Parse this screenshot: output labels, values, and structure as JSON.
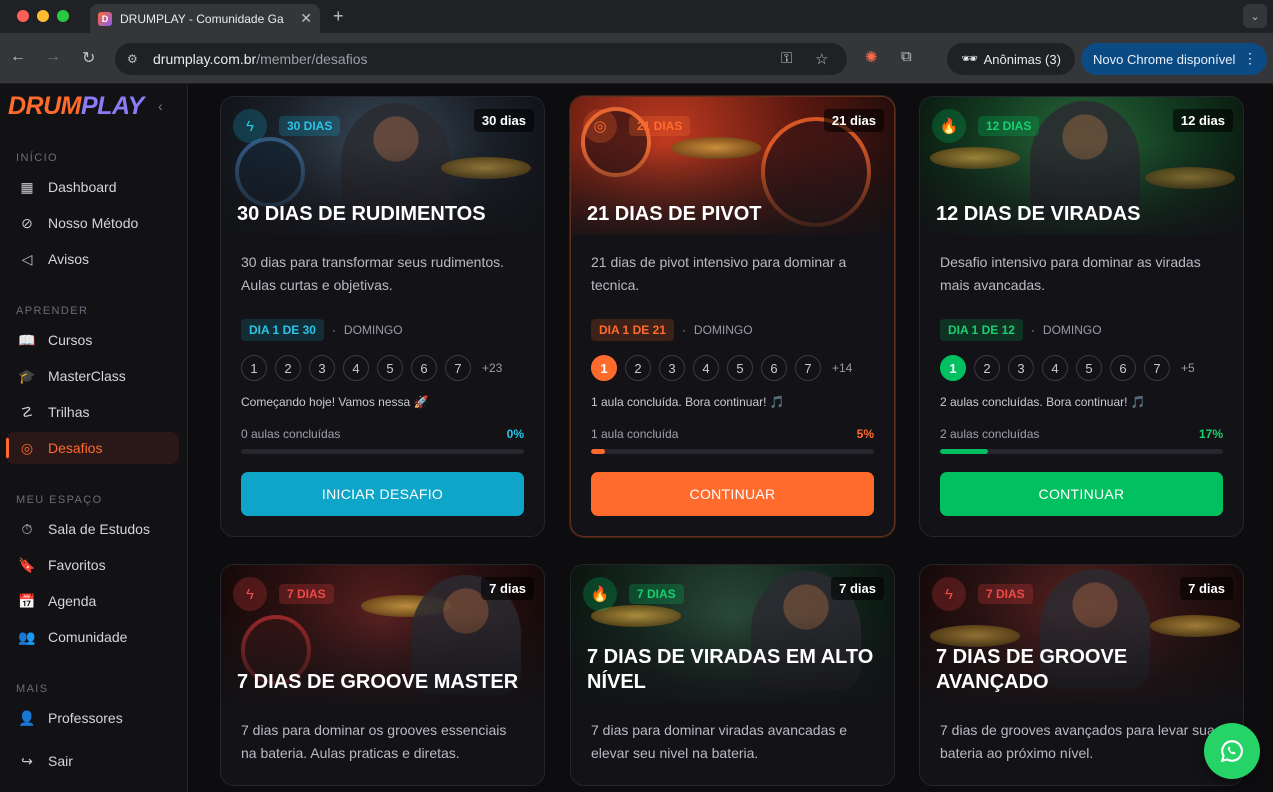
{
  "browser": {
    "tab_title": "DRUMPLAY - Comunidade Ga",
    "tab_favicon": "D",
    "url_host": "drumplay.com.br",
    "url_path": "/member/desafios",
    "incognito_label": "Anônimas (3)",
    "update_label": "Novo Chrome disponível"
  },
  "brand": {
    "part1": "DRUM",
    "part2": "PLAY"
  },
  "sidebar": {
    "sections": [
      {
        "title": "INÍCIO"
      },
      {
        "title": "APRENDER"
      },
      {
        "title": "MEU ESPAÇO"
      },
      {
        "title": "MAIS"
      }
    ],
    "items": [
      {
        "label": "Dashboard",
        "icon": "grid-icon"
      },
      {
        "label": "Nosso Método",
        "icon": "compass-icon"
      },
      {
        "label": "Avisos",
        "icon": "megaphone-icon"
      },
      {
        "label": "Cursos",
        "icon": "book-icon"
      },
      {
        "label": "MasterClass",
        "icon": "graduation-cap-icon"
      },
      {
        "label": "Trilhas",
        "icon": "route-icon"
      },
      {
        "label": "Desafios",
        "icon": "target-icon",
        "active": true
      },
      {
        "label": "Sala de Estudos",
        "icon": "timer-icon"
      },
      {
        "label": "Favoritos",
        "icon": "bookmark-icon"
      },
      {
        "label": "Agenda",
        "icon": "calendar-icon"
      },
      {
        "label": "Comunidade",
        "icon": "users-icon"
      },
      {
        "label": "Professores",
        "icon": "user-icon"
      },
      {
        "label": "Sair",
        "icon": "logout-icon"
      }
    ]
  },
  "cards": [
    {
      "title": "30 DIAS DE RUDIMENTOS",
      "pill": "30 DIAS",
      "duration": "30 dias",
      "description": "30 dias para transformar seus rudimentos. Aulas curtas e objetivas.",
      "day_label": "DIA 1 DE 30",
      "weekday": "DOMINGO",
      "days": [
        "1",
        "2",
        "3",
        "4",
        "5",
        "6",
        "7"
      ],
      "more": "+23",
      "status": "Começando hoje! Vamos nessa 🚀",
      "progress_label": "0 aulas concluídas",
      "progress_pct": "0%",
      "progress": 0,
      "button": "INICIAR DESAFIO",
      "accent": "#0ea5c9",
      "icon": "bolt-icon"
    },
    {
      "title": "21 DIAS DE PIVOT",
      "pill": "21 DIAS",
      "duration": "21 dias",
      "description": "21 dias de pivot intensivo para dominar a tecnica.",
      "day_label": "DIA 1 DE 21",
      "weekday": "DOMINGO",
      "days": [
        "1",
        "2",
        "3",
        "4",
        "5",
        "6",
        "7"
      ],
      "more": "+14",
      "status": "1 aula concluída. Bora continuar! 🎵",
      "progress_label": "1 aula concluída",
      "progress_pct": "5%",
      "progress": 0.05,
      "button": "CONTINUAR",
      "accent": "#ff6b2c",
      "icon": "target-icon"
    },
    {
      "title": "12 DIAS DE VIRADAS",
      "pill": "12 DIAS",
      "duration": "12 dias",
      "description": "Desafio intensivo para dominar as viradas mais avancadas.",
      "day_label": "DIA 1 DE 12",
      "weekday": "DOMINGO",
      "days": [
        "1",
        "2",
        "3",
        "4",
        "5",
        "6",
        "7"
      ],
      "more": "+5",
      "status": "2 aulas concluídas. Bora continuar! 🎵",
      "progress_label": "2 aulas concluídas",
      "progress_pct": "17%",
      "progress": 0.17,
      "button": "CONTINUAR",
      "accent": "#00c060",
      "icon": "flame-icon"
    },
    {
      "title": "7 DIAS DE GROOVE MASTER",
      "pill": "7 DIAS",
      "duration": "7 dias",
      "description": "7 dias para dominar os grooves essenciais na bateria. Aulas praticas e diretas.",
      "accent": "#e03a3a",
      "icon": "bolt-icon"
    },
    {
      "title": "7 DIAS DE VIRADAS EM ALTO NÍVEL",
      "pill": "7 DIAS",
      "duration": "7 dias",
      "description": "7 dias para dominar viradas avancadas e elevar seu nivel na bateria.",
      "accent": "#00c060",
      "icon": "flame-icon"
    },
    {
      "title": "7 DIAS DE GROOVE AVANÇADO",
      "pill": "7 DIAS",
      "duration": "7 dias",
      "description": "7 dias de grooves avançados para levar sua bateria ao próximo nível.",
      "accent": "#e03a3a",
      "icon": "bolt-icon"
    }
  ]
}
